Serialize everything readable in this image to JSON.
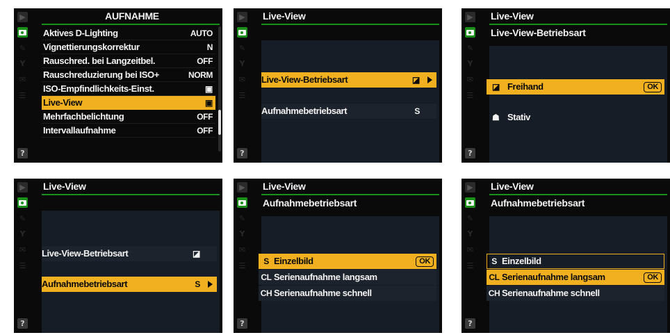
{
  "screens": {
    "s1": {
      "title": "AUFNAHME",
      "rows": [
        {
          "label": "Aktives D-Lighting",
          "value": "AUTO"
        },
        {
          "label": "Vignettierungskorrektur",
          "value": "N"
        },
        {
          "label": "Rauschred. bei Langzeitbel.",
          "value": "OFF"
        },
        {
          "label": "Rauschreduzierung bei ISO+",
          "value": "NORM"
        },
        {
          "label": "ISO-Empfindlichkeits-Einst.",
          "value": ""
        },
        {
          "label": "Live-View",
          "value": ""
        },
        {
          "label": "Mehrfachbelichtung",
          "value": "OFF"
        },
        {
          "label": "Intervallaufnahme",
          "value": "OFF"
        }
      ],
      "help": "?"
    },
    "s2": {
      "title": "Live-View",
      "rows": [
        {
          "label": "Live-View-Betriebsart",
          "value": ""
        },
        {
          "label": "Aufnahmebetriebsart",
          "value": "S"
        }
      ],
      "help": "?"
    },
    "s3": {
      "title": "Live-View",
      "subtitle": "Live-View-Betriebsart",
      "rows": [
        {
          "label": "Freihand",
          "ok": "OK"
        },
        {
          "label": "Stativ"
        }
      ],
      "help": "?"
    },
    "s4": {
      "title": "Live-View",
      "rows": [
        {
          "label": "Live-View-Betriebsart",
          "value": ""
        },
        {
          "label": "Aufnahmebetriebsart",
          "value": "S"
        }
      ],
      "help": "?"
    },
    "s5": {
      "title": "Live-View",
      "subtitle": "Aufnahmebetriebsart",
      "rows": [
        {
          "code": "S",
          "label": "Einzelbild",
          "ok": "OK"
        },
        {
          "code": "CL",
          "label": "Serienaufnahme langsam"
        },
        {
          "code": "CH",
          "label": "Serienaufnahme schnell"
        }
      ],
      "help": "?"
    },
    "s6": {
      "title": "Live-View",
      "subtitle": "Aufnahmebetriebsart",
      "rows": [
        {
          "code": "S",
          "label": "Einzelbild"
        },
        {
          "code": "CL",
          "label": "Serienaufnahme langsam",
          "ok": "OK"
        },
        {
          "code": "CH",
          "label": "Serienaufnahme schnell"
        }
      ],
      "help": "?"
    }
  },
  "colors": {
    "accent_green": "#1a8f1a",
    "highlight_orange": "#f0b020",
    "background": "#0a0a0a",
    "panel": "#161d26"
  }
}
